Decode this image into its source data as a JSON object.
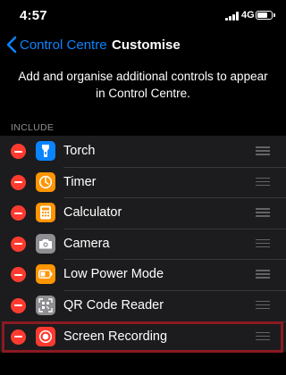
{
  "status_bar": {
    "time": "4:57",
    "network": "4G",
    "icons": [
      "signal-icon",
      "battery-icon"
    ]
  },
  "nav": {
    "back_label": "Control Centre",
    "title": "Customise",
    "back_icon": "chevron-left-icon"
  },
  "description": "Add and organise additional controls to appear in Control Centre.",
  "section": {
    "header": "INCLUDE",
    "items": [
      {
        "label": "Torch",
        "icon": "torch-icon",
        "color": "#0a84ff"
      },
      {
        "label": "Timer",
        "icon": "timer-icon",
        "color": "#ff9500"
      },
      {
        "label": "Calculator",
        "icon": "calculator-icon",
        "color": "#ff9500"
      },
      {
        "label": "Camera",
        "icon": "camera-icon",
        "color": "#8e8e93"
      },
      {
        "label": "Low Power Mode",
        "icon": "battery-icon",
        "color": "#ff9500"
      },
      {
        "label": "QR Code Reader",
        "icon": "qr-code-icon",
        "color": "#8e8e93"
      },
      {
        "label": "Screen Recording",
        "icon": "record-icon",
        "color": "#ff3b30"
      }
    ]
  },
  "colors": {
    "accent": "#0a84ff",
    "remove": "#ff3b30",
    "highlight": "#8b1a22",
    "background": "#000000",
    "row_background": "#1c1c1e"
  }
}
